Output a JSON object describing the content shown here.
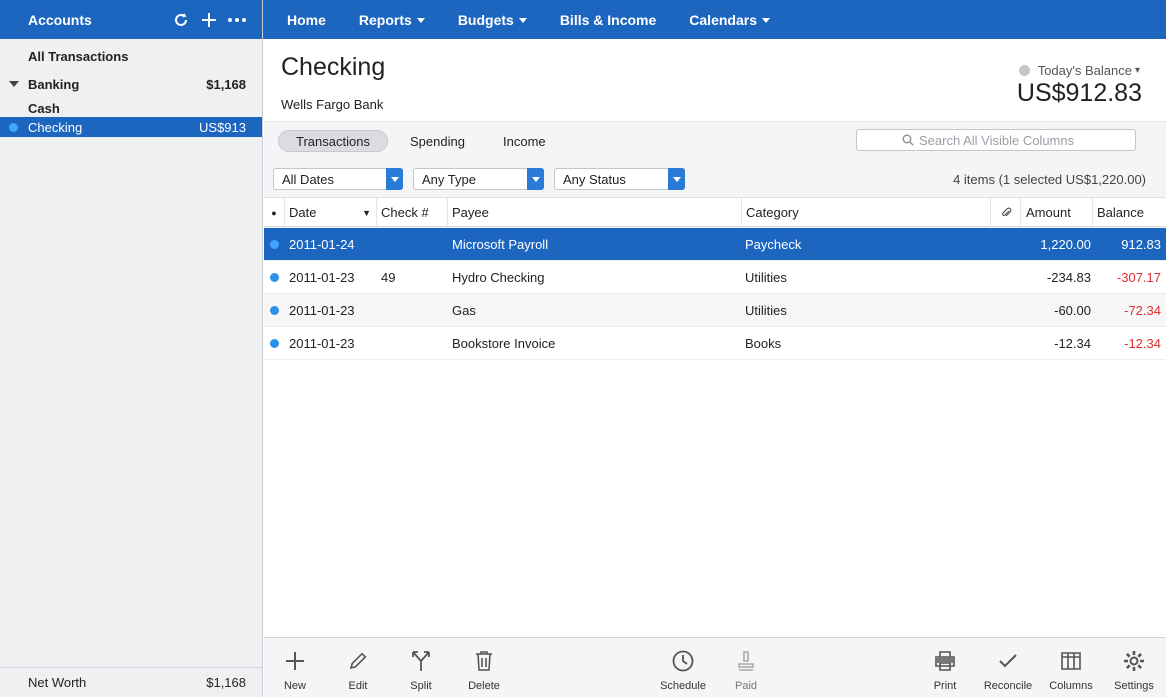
{
  "sidebar": {
    "title": "Accounts",
    "all_transactions": "All Transactions",
    "groups": [
      {
        "label": "Banking",
        "amount": "$1,168"
      }
    ],
    "accounts": [
      {
        "label": "Cash",
        "amount": ""
      },
      {
        "label": "Checking",
        "amount": "US$913"
      }
    ],
    "footer": {
      "label": "Net Worth",
      "amount": "$1,168"
    }
  },
  "nav": {
    "items": [
      {
        "label": "Home"
      },
      {
        "label": "Reports"
      },
      {
        "label": "Budgets"
      },
      {
        "label": "Bills & Income"
      },
      {
        "label": "Calendars"
      }
    ]
  },
  "account": {
    "name": "Checking",
    "institution": "Wells Fargo Bank",
    "balance_label": "Today's Balance",
    "balance": "US$912.83"
  },
  "tabs": [
    "Transactions",
    "Spending",
    "Income"
  ],
  "search": {
    "placeholder": "Search All Visible Columns"
  },
  "filters": {
    "dates": "All Dates",
    "type": "Any Type",
    "status": "Any Status"
  },
  "items_info": "4 items (1 selected US$1,220.00)",
  "table": {
    "headers": {
      "status": "●",
      "date": "Date",
      "check": "Check #",
      "payee": "Payee",
      "category": "Category",
      "amount": "Amount",
      "balance": "Balance"
    },
    "rows": [
      {
        "date": "2011-01-24",
        "check": "",
        "payee": "Microsoft Payroll",
        "category": "Paycheck",
        "amount": "1,220.00",
        "balance": "912.83"
      },
      {
        "date": "2011-01-23",
        "check": "49",
        "payee": "Hydro Checking",
        "category": "Utilities",
        "amount": "-234.83",
        "balance": "-307.17"
      },
      {
        "date": "2011-01-23",
        "check": "",
        "payee": "Gas",
        "category": "Utilities",
        "amount": "-60.00",
        "balance": "-72.34"
      },
      {
        "date": "2011-01-23",
        "check": "",
        "payee": "Bookstore Invoice",
        "category": "Books",
        "amount": "-12.34",
        "balance": "-12.34"
      }
    ]
  },
  "toolbar": {
    "new": "New",
    "edit": "Edit",
    "split": "Split",
    "delete": "Delete",
    "schedule": "Schedule",
    "paid": "Paid",
    "print": "Print",
    "reconcile": "Reconcile",
    "columns": "Columns",
    "settings": "Settings"
  },
  "colors": {
    "accent": "#1d66c0",
    "negative": "#e03030",
    "status_dot": "#2a90e8"
  }
}
